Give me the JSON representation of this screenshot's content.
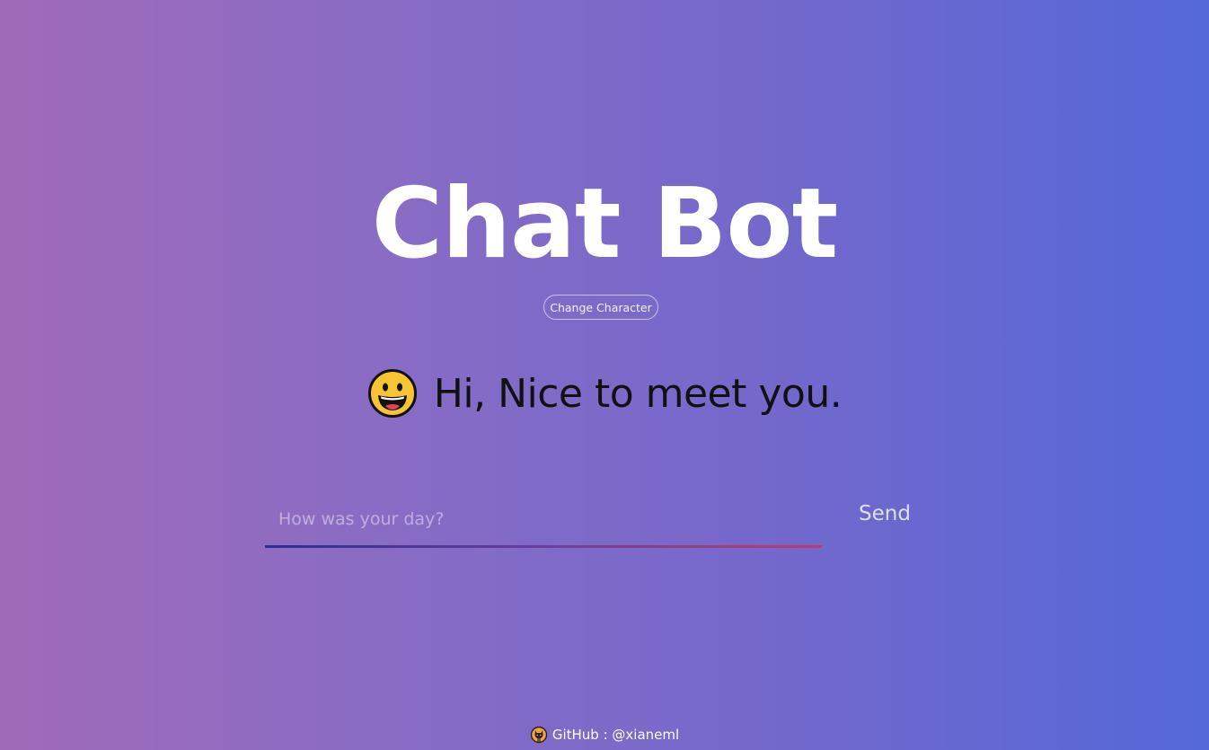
{
  "header": {
    "title": "Chat Bot"
  },
  "character": {
    "change_label": "Change Character",
    "avatar_icon": "grinning-face-icon",
    "greeting": "Hi, Nice to meet you."
  },
  "composer": {
    "placeholder": "How was your day?",
    "value": "",
    "send_label": "Send"
  },
  "footer": {
    "icon": "octocat-icon",
    "github_label": "GitHub : @xianeml"
  },
  "colors": {
    "gradient_left": "#a06ab8",
    "gradient_right": "#5468d8",
    "underline_start": "#2b2f8e",
    "underline_end": "#c03a6a",
    "avatar_face": "#f7c531"
  }
}
